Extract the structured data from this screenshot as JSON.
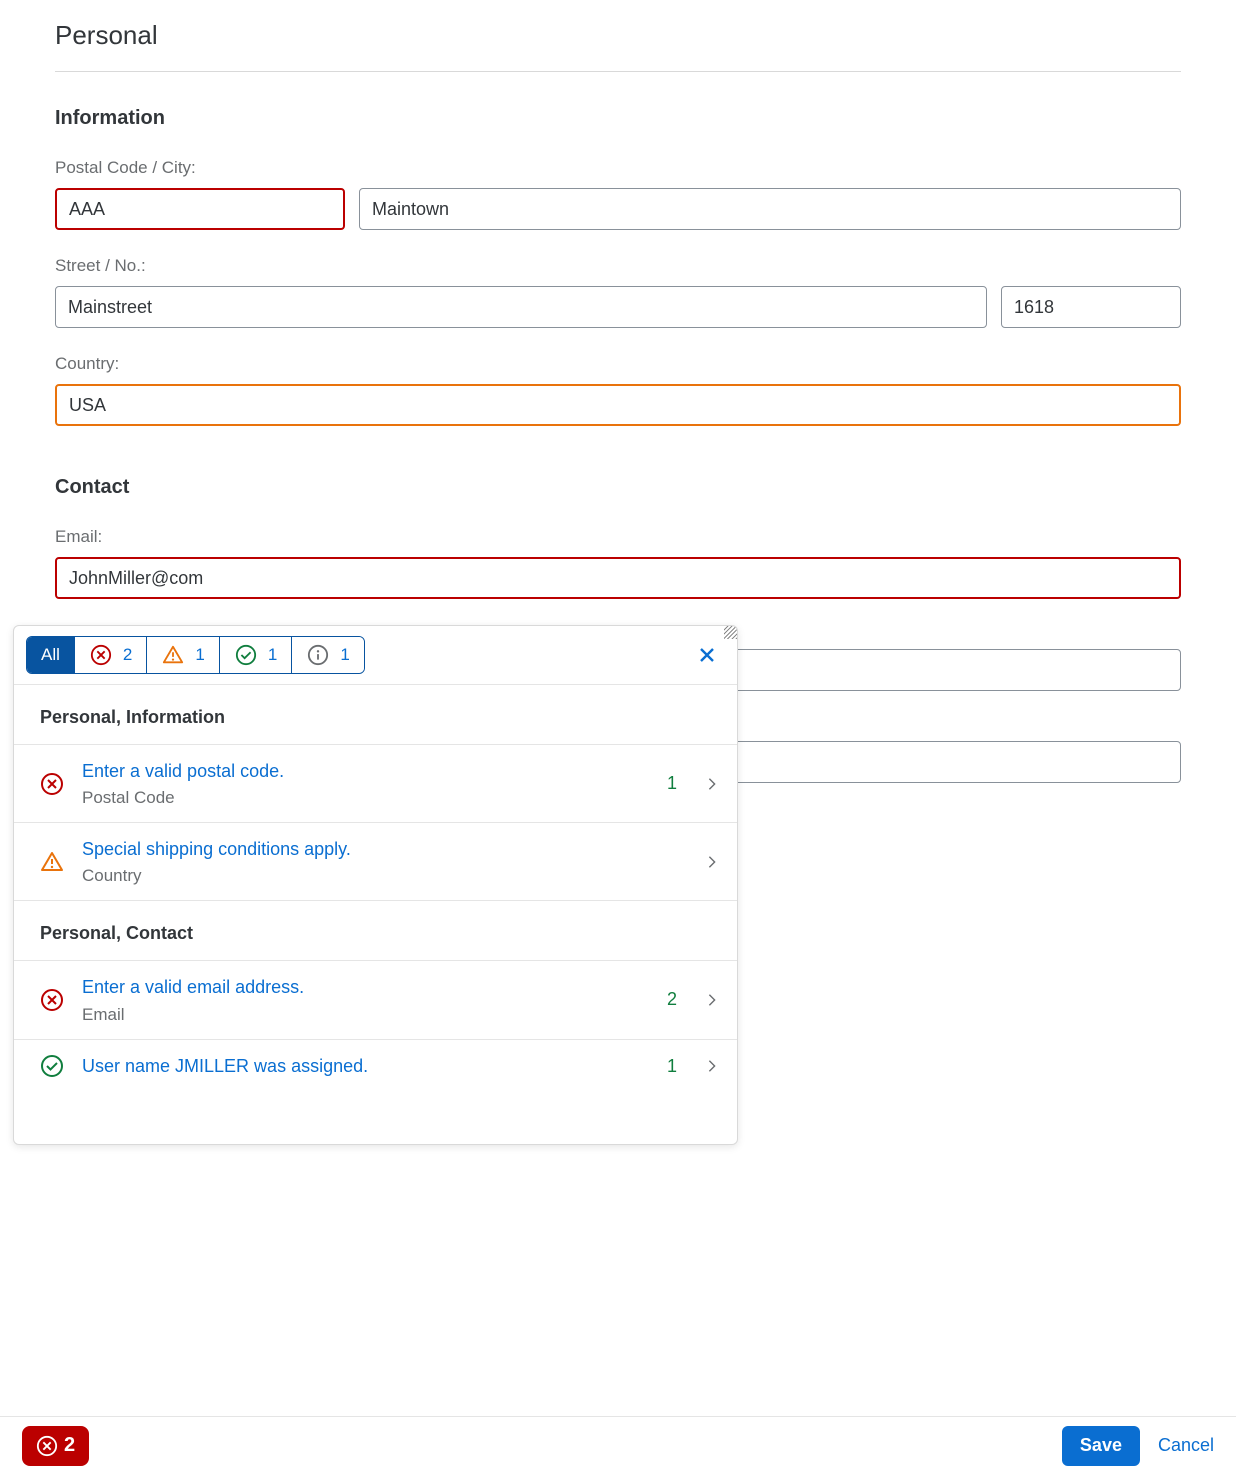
{
  "page": {
    "title": "Personal"
  },
  "sections": {
    "information": {
      "title": "Information",
      "postal_city_label": "Postal Code / City:",
      "postal_value": "AAA",
      "city_value": "Maintown",
      "street_no_label": "Street / No.:",
      "street_value": "Mainstreet",
      "no_value": "1618",
      "country_label": "Country:",
      "country_value": "USA"
    },
    "contact": {
      "title": "Contact",
      "email_label": "Email:",
      "email_value": "JohnMiller@com"
    }
  },
  "popover": {
    "filters": {
      "all_label": "All",
      "error_count": "2",
      "warning_count": "1",
      "success_count": "1",
      "info_count": "1"
    },
    "groups": [
      {
        "header": "Personal, Information",
        "items": [
          {
            "type": "error",
            "title": "Enter a valid postal code.",
            "sub": "Postal Code",
            "count": "1"
          },
          {
            "type": "warning",
            "title": "Special shipping conditions apply.",
            "sub": "Country",
            "count": ""
          }
        ]
      },
      {
        "header": "Personal, Contact",
        "items": [
          {
            "type": "error",
            "title": "Enter a valid email address.",
            "sub": "Email",
            "count": "2"
          },
          {
            "type": "success",
            "title": "User name JMILLER was assigned.",
            "sub": "",
            "count": "1"
          }
        ]
      }
    ]
  },
  "footer": {
    "error_count": "2",
    "save_label": "Save",
    "cancel_label": "Cancel"
  }
}
